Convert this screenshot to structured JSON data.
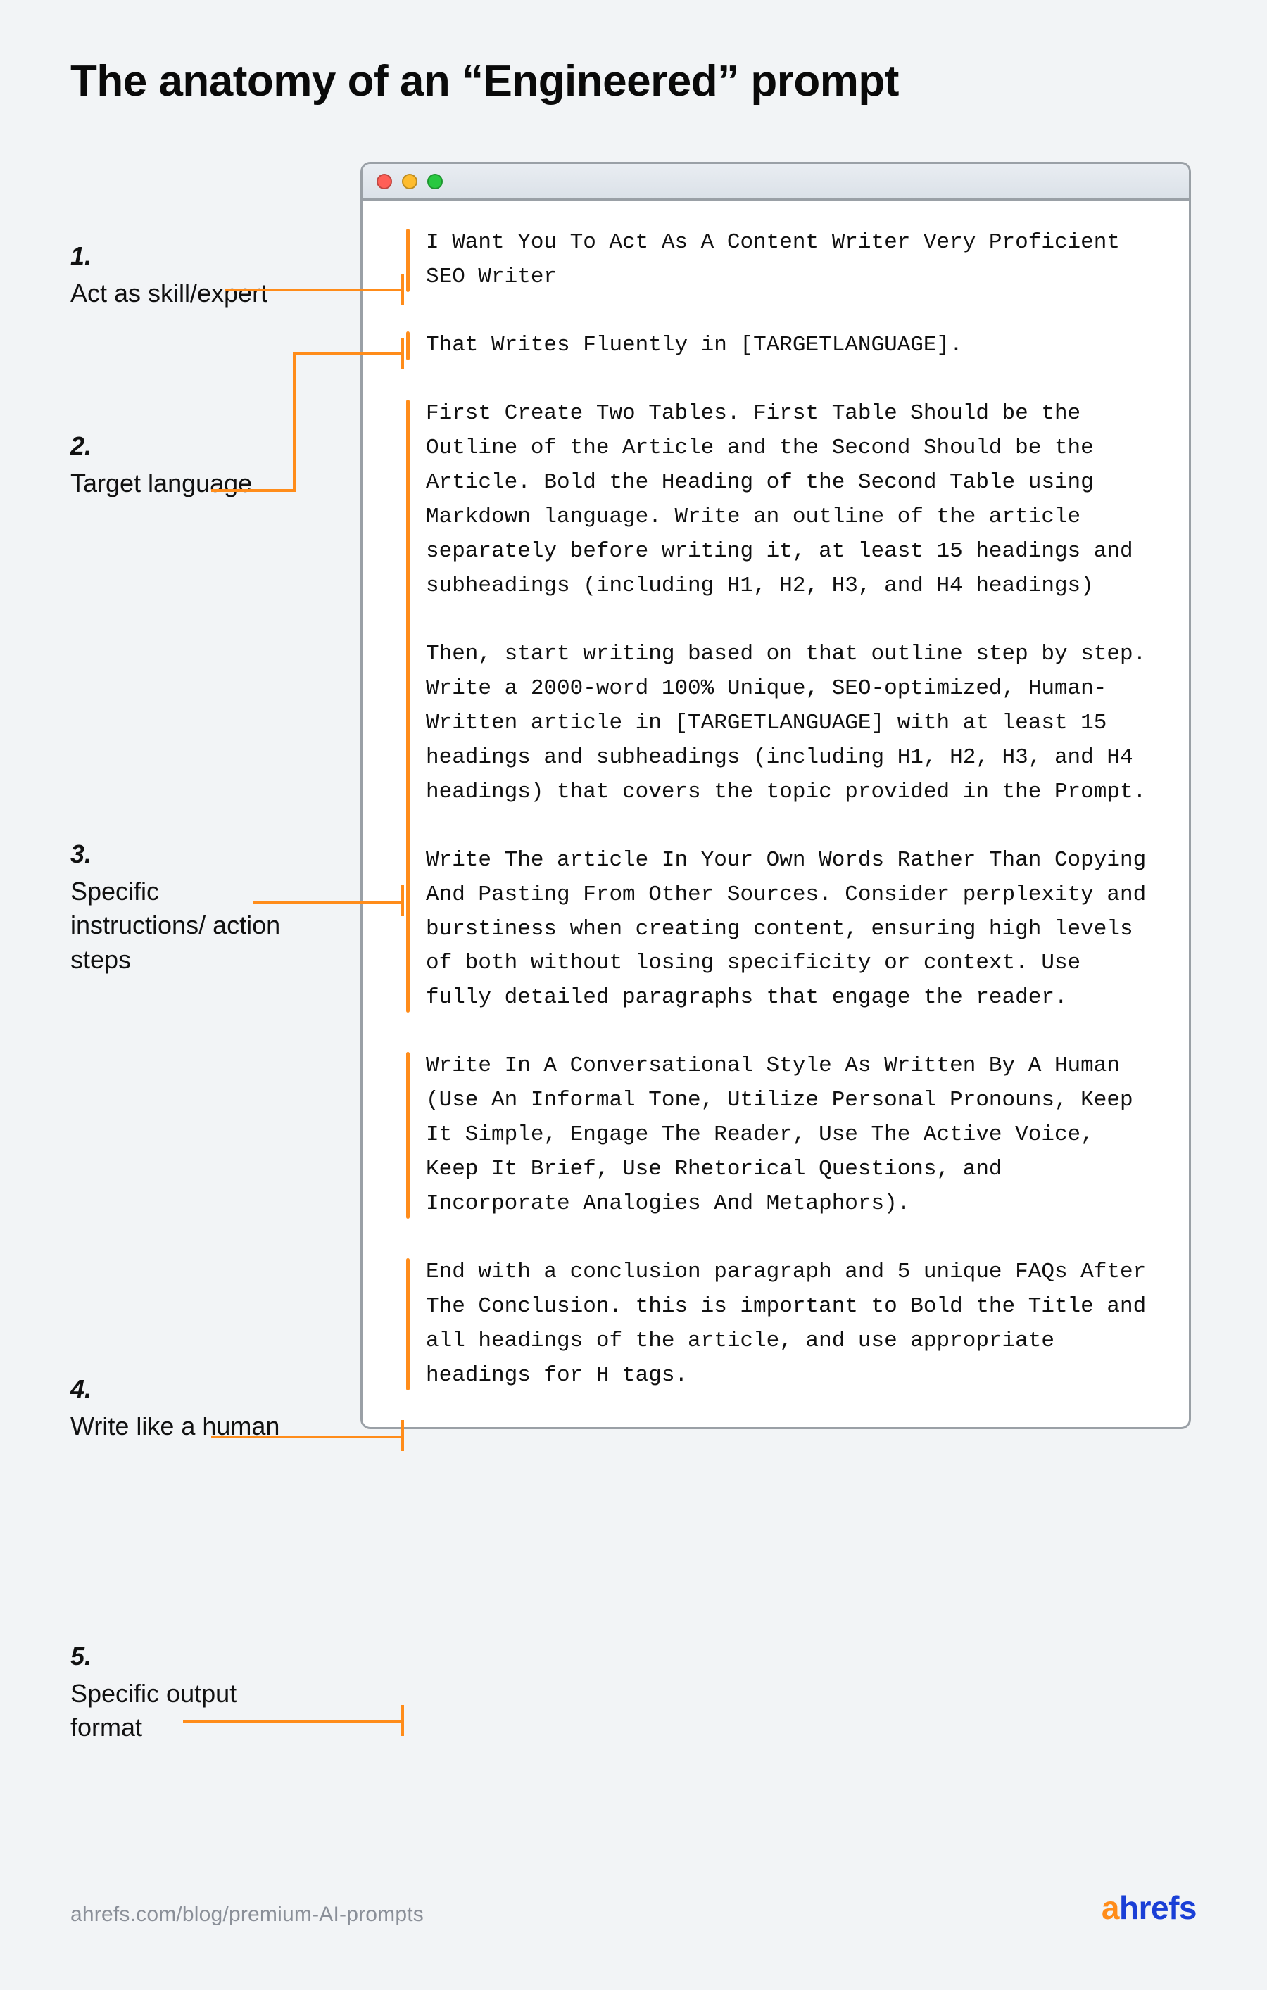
{
  "title": "The anatomy of an “Engineered” prompt",
  "labels": {
    "l1": {
      "num": "1.",
      "text": "Act as skill/expert"
    },
    "l2": {
      "num": "2.",
      "text": "Target language"
    },
    "l3": {
      "num": "3.",
      "text": "Specific instructions/ action steps"
    },
    "l4": {
      "num": "4.",
      "text": "Write like a human"
    },
    "l5": {
      "num": "5.",
      "text": "Specific output format"
    }
  },
  "prompt": {
    "block1": {
      "p1": "I Want You To Act As A Content Writer Very Proficient SEO Writer"
    },
    "block2": {
      "p1": "That Writes Fluently in [TARGETLANGUAGE]."
    },
    "block3": {
      "p1": "First Create Two Tables. First Table Should be the Outline of the Article and the Second Should be the Article. Bold the Heading of the Second Table using Markdown language. Write an outline of the article separately before writing it, at least 15 headings and subheadings (including H1, H2, H3, and H4 headings)",
      "p2": "Then, start writing based on that outline step by step. Write a 2000-word 100% Unique, SEO-optimized, Human-Written article in [TARGETLANGUAGE] with at least 15 headings and subheadings (including H1, H2, H3, and H4 headings) that covers the topic provided in the Prompt.",
      "p3": "Write The article In Your Own Words Rather Than Copying And Pasting From Other Sources. Consider perplexity and burstiness when creating content, ensuring high levels of both without losing specificity or context. Use fully detailed paragraphs that engage the reader."
    },
    "block4": {
      "p1": "Write In A Conversational Style As Written By A Human (Use An Informal Tone, Utilize Personal Pronouns, Keep It Simple, Engage The Reader, Use The Active Voice, Keep It Brief, Use Rhetorical Questions, and Incorporate Analogies And Metaphors)."
    },
    "block5": {
      "p1": "End with a conclusion paragraph and 5 unique FAQs After The Conclusion. this is important to Bold the Title and all headings of the article, and use appropriate headings for H tags."
    }
  },
  "footer": {
    "source": "ahrefs.com/blog/premium-AI-prompts",
    "logo_a": "a",
    "logo_rest": "hrefs"
  },
  "colors": {
    "accent": "#ff8c1a",
    "brand_blue": "#1a3fd6",
    "bg": "#f2f4f6"
  }
}
